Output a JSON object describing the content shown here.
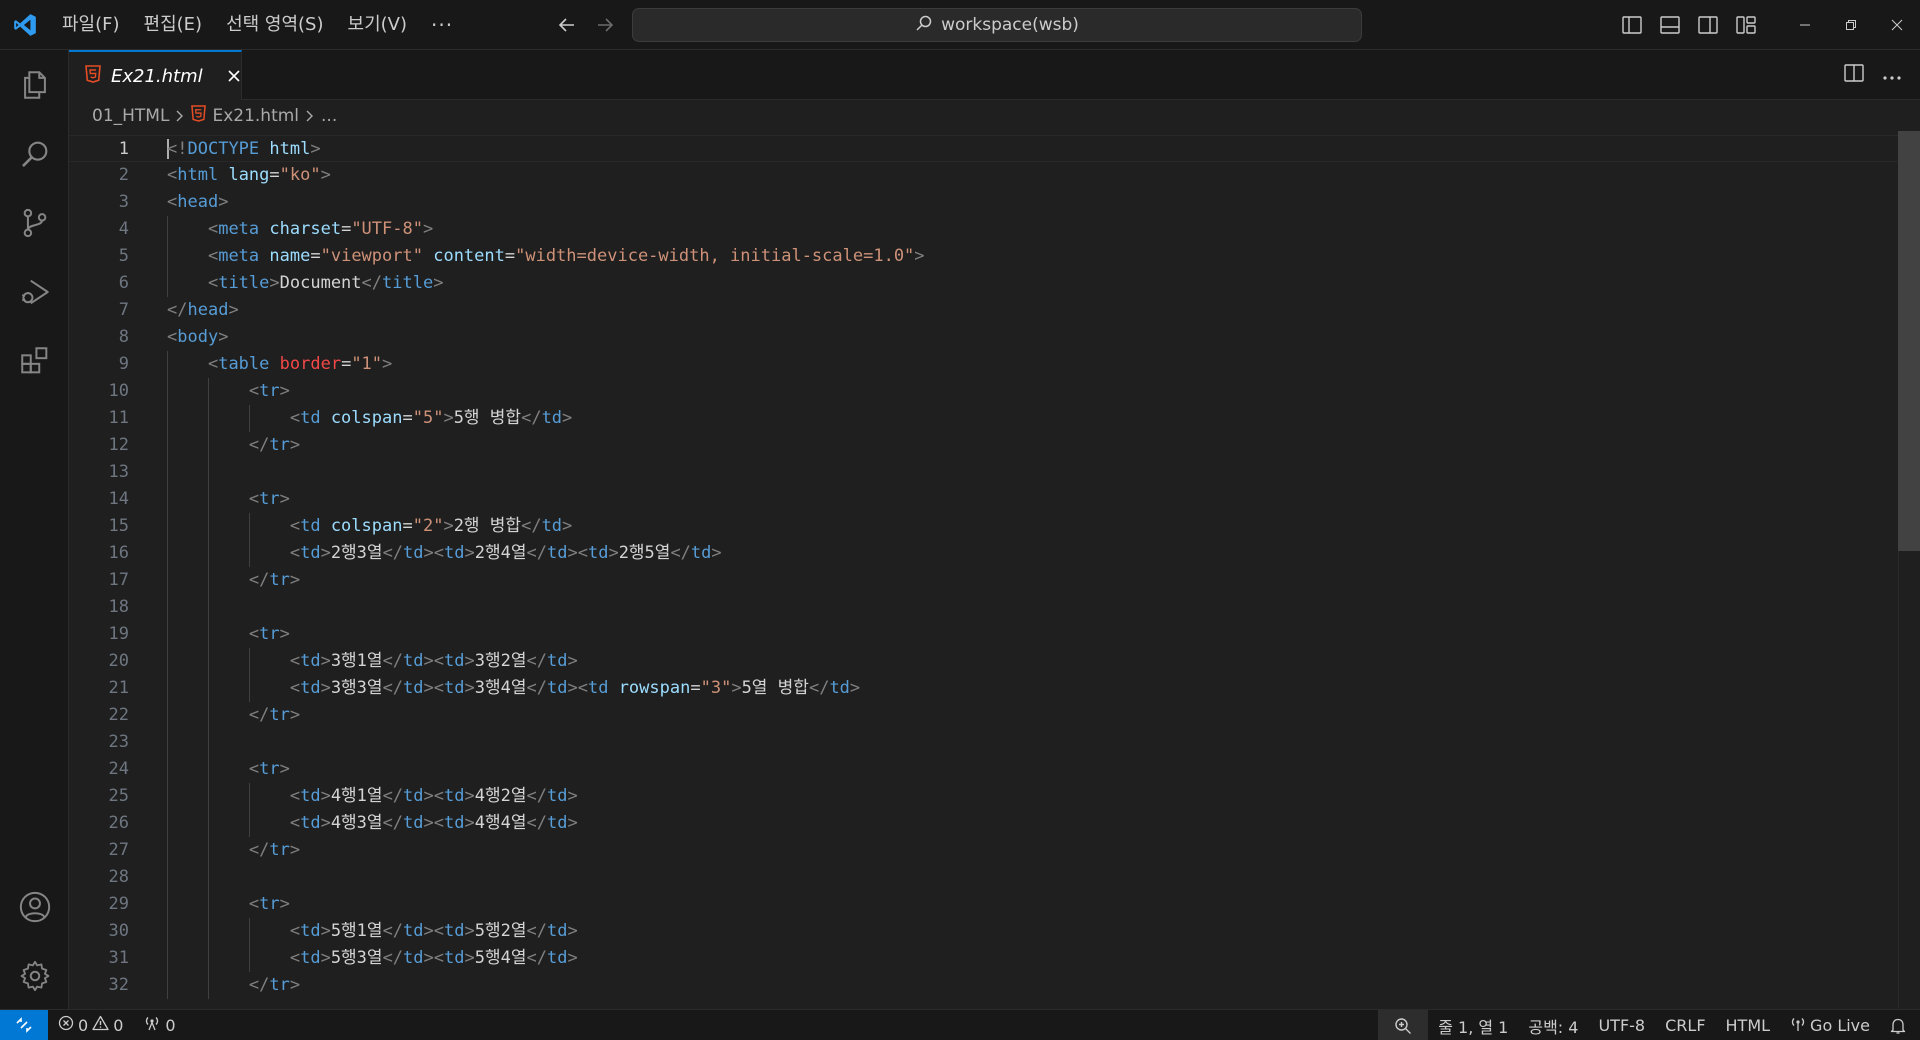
{
  "titlebar": {
    "menu": [
      "파일(F)",
      "편집(E)",
      "선택 영역(S)",
      "보기(V)"
    ],
    "more": "···",
    "search_text": "workspace(wsb)"
  },
  "tab": {
    "label": "Ex21.html"
  },
  "breadcrumb": {
    "folder": "01_HTML",
    "file": "Ex21.html",
    "more": "..."
  },
  "code": [
    [
      [
        "p",
        "<"
      ],
      [
        "p",
        "!"
      ],
      [
        "tag",
        "DOCTYPE"
      ],
      [
        "text",
        " "
      ],
      [
        "attr",
        "html"
      ],
      [
        "p",
        ">"
      ]
    ],
    [
      [
        "p",
        "<"
      ],
      [
        "tag",
        "html"
      ],
      [
        "text",
        " "
      ],
      [
        "attr",
        "lang"
      ],
      [
        "text",
        "="
      ],
      [
        "str",
        "\"ko\""
      ],
      [
        "p",
        ">"
      ]
    ],
    [
      [
        "p",
        "<"
      ],
      [
        "tag",
        "head"
      ],
      [
        "p",
        ">"
      ]
    ],
    [
      [
        "text",
        "    "
      ],
      [
        "p",
        "<"
      ],
      [
        "tag",
        "meta"
      ],
      [
        "text",
        " "
      ],
      [
        "attr",
        "charset"
      ],
      [
        "text",
        "="
      ],
      [
        "str",
        "\"UTF-8\""
      ],
      [
        "p",
        ">"
      ]
    ],
    [
      [
        "text",
        "    "
      ],
      [
        "p",
        "<"
      ],
      [
        "tag",
        "meta"
      ],
      [
        "text",
        " "
      ],
      [
        "attr",
        "name"
      ],
      [
        "text",
        "="
      ],
      [
        "str",
        "\"viewport\""
      ],
      [
        "text",
        " "
      ],
      [
        "attr",
        "content"
      ],
      [
        "text",
        "="
      ],
      [
        "str",
        "\"width=device-width, initial-scale=1.0\""
      ],
      [
        "p",
        ">"
      ]
    ],
    [
      [
        "text",
        "    "
      ],
      [
        "p",
        "<"
      ],
      [
        "tag",
        "title"
      ],
      [
        "p",
        ">"
      ],
      [
        "text",
        "Document"
      ],
      [
        "p",
        "</"
      ],
      [
        "tag",
        "title"
      ],
      [
        "p",
        ">"
      ]
    ],
    [
      [
        "p",
        "</"
      ],
      [
        "tag",
        "head"
      ],
      [
        "p",
        ">"
      ]
    ],
    [
      [
        "p",
        "<"
      ],
      [
        "tag",
        "body"
      ],
      [
        "p",
        ">"
      ]
    ],
    [
      [
        "text",
        "    "
      ],
      [
        "p",
        "<"
      ],
      [
        "tag",
        "table"
      ],
      [
        "text",
        " "
      ],
      [
        "err",
        "border"
      ],
      [
        "text",
        "="
      ],
      [
        "str",
        "\"1\""
      ],
      [
        "p",
        ">"
      ]
    ],
    [
      [
        "text",
        "        "
      ],
      [
        "p",
        "<"
      ],
      [
        "tag",
        "tr"
      ],
      [
        "p",
        ">"
      ]
    ],
    [
      [
        "text",
        "            "
      ],
      [
        "p",
        "<"
      ],
      [
        "tag",
        "td"
      ],
      [
        "text",
        " "
      ],
      [
        "attr",
        "colspan"
      ],
      [
        "text",
        "="
      ],
      [
        "str",
        "\"5\""
      ],
      [
        "p",
        ">"
      ],
      [
        "text",
        "5행 병합"
      ],
      [
        "p",
        "</"
      ],
      [
        "tag",
        "td"
      ],
      [
        "p",
        ">"
      ]
    ],
    [
      [
        "text",
        "        "
      ],
      [
        "p",
        "</"
      ],
      [
        "tag",
        "tr"
      ],
      [
        "p",
        ">"
      ]
    ],
    [],
    [
      [
        "text",
        "        "
      ],
      [
        "p",
        "<"
      ],
      [
        "tag",
        "tr"
      ],
      [
        "p",
        ">"
      ]
    ],
    [
      [
        "text",
        "            "
      ],
      [
        "p",
        "<"
      ],
      [
        "tag",
        "td"
      ],
      [
        "text",
        " "
      ],
      [
        "attr",
        "colspan"
      ],
      [
        "text",
        "="
      ],
      [
        "str",
        "\"2\""
      ],
      [
        "p",
        ">"
      ],
      [
        "text",
        "2행 병합"
      ],
      [
        "p",
        "</"
      ],
      [
        "tag",
        "td"
      ],
      [
        "p",
        ">"
      ]
    ],
    [
      [
        "text",
        "            "
      ],
      [
        "p",
        "<"
      ],
      [
        "tag",
        "td"
      ],
      [
        "p",
        ">"
      ],
      [
        "text",
        "2행3열"
      ],
      [
        "p",
        "</"
      ],
      [
        "tag",
        "td"
      ],
      [
        "p",
        "><"
      ],
      [
        "tag",
        "td"
      ],
      [
        "p",
        ">"
      ],
      [
        "text",
        "2행4열"
      ],
      [
        "p",
        "</"
      ],
      [
        "tag",
        "td"
      ],
      [
        "p",
        "><"
      ],
      [
        "tag",
        "td"
      ],
      [
        "p",
        ">"
      ],
      [
        "text",
        "2행5열"
      ],
      [
        "p",
        "</"
      ],
      [
        "tag",
        "td"
      ],
      [
        "p",
        ">"
      ]
    ],
    [
      [
        "text",
        "        "
      ],
      [
        "p",
        "</"
      ],
      [
        "tag",
        "tr"
      ],
      [
        "p",
        ">"
      ]
    ],
    [],
    [
      [
        "text",
        "        "
      ],
      [
        "p",
        "<"
      ],
      [
        "tag",
        "tr"
      ],
      [
        "p",
        ">"
      ]
    ],
    [
      [
        "text",
        "            "
      ],
      [
        "p",
        "<"
      ],
      [
        "tag",
        "td"
      ],
      [
        "p",
        ">"
      ],
      [
        "text",
        "3행1열"
      ],
      [
        "p",
        "</"
      ],
      [
        "tag",
        "td"
      ],
      [
        "p",
        "><"
      ],
      [
        "tag",
        "td"
      ],
      [
        "p",
        ">"
      ],
      [
        "text",
        "3행2열"
      ],
      [
        "p",
        "</"
      ],
      [
        "tag",
        "td"
      ],
      [
        "p",
        ">"
      ]
    ],
    [
      [
        "text",
        "            "
      ],
      [
        "p",
        "<"
      ],
      [
        "tag",
        "td"
      ],
      [
        "p",
        ">"
      ],
      [
        "text",
        "3행3열"
      ],
      [
        "p",
        "</"
      ],
      [
        "tag",
        "td"
      ],
      [
        "p",
        "><"
      ],
      [
        "tag",
        "td"
      ],
      [
        "p",
        ">"
      ],
      [
        "text",
        "3행4열"
      ],
      [
        "p",
        "</"
      ],
      [
        "tag",
        "td"
      ],
      [
        "p",
        "><"
      ],
      [
        "tag",
        "td"
      ],
      [
        "text",
        " "
      ],
      [
        "attr",
        "rowspan"
      ],
      [
        "text",
        "="
      ],
      [
        "str",
        "\"3\""
      ],
      [
        "p",
        ">"
      ],
      [
        "text",
        "5열 병합"
      ],
      [
        "p",
        "</"
      ],
      [
        "tag",
        "td"
      ],
      [
        "p",
        ">"
      ]
    ],
    [
      [
        "text",
        "        "
      ],
      [
        "p",
        "</"
      ],
      [
        "tag",
        "tr"
      ],
      [
        "p",
        ">"
      ]
    ],
    [],
    [
      [
        "text",
        "        "
      ],
      [
        "p",
        "<"
      ],
      [
        "tag",
        "tr"
      ],
      [
        "p",
        ">"
      ]
    ],
    [
      [
        "text",
        "            "
      ],
      [
        "p",
        "<"
      ],
      [
        "tag",
        "td"
      ],
      [
        "p",
        ">"
      ],
      [
        "text",
        "4행1열"
      ],
      [
        "p",
        "</"
      ],
      [
        "tag",
        "td"
      ],
      [
        "p",
        "><"
      ],
      [
        "tag",
        "td"
      ],
      [
        "p",
        ">"
      ],
      [
        "text",
        "4행2열"
      ],
      [
        "p",
        "</"
      ],
      [
        "tag",
        "td"
      ],
      [
        "p",
        ">"
      ]
    ],
    [
      [
        "text",
        "            "
      ],
      [
        "p",
        "<"
      ],
      [
        "tag",
        "td"
      ],
      [
        "p",
        ">"
      ],
      [
        "text",
        "4행3열"
      ],
      [
        "p",
        "</"
      ],
      [
        "tag",
        "td"
      ],
      [
        "p",
        "><"
      ],
      [
        "tag",
        "td"
      ],
      [
        "p",
        ">"
      ],
      [
        "text",
        "4행4열"
      ],
      [
        "p",
        "</"
      ],
      [
        "tag",
        "td"
      ],
      [
        "p",
        ">"
      ]
    ],
    [
      [
        "text",
        "        "
      ],
      [
        "p",
        "</"
      ],
      [
        "tag",
        "tr"
      ],
      [
        "p",
        ">"
      ]
    ],
    [],
    [
      [
        "text",
        "        "
      ],
      [
        "p",
        "<"
      ],
      [
        "tag",
        "tr"
      ],
      [
        "p",
        ">"
      ]
    ],
    [
      [
        "text",
        "            "
      ],
      [
        "p",
        "<"
      ],
      [
        "tag",
        "td"
      ],
      [
        "p",
        ">"
      ],
      [
        "text",
        "5행1열"
      ],
      [
        "p",
        "</"
      ],
      [
        "tag",
        "td"
      ],
      [
        "p",
        "><"
      ],
      [
        "tag",
        "td"
      ],
      [
        "p",
        ">"
      ],
      [
        "text",
        "5행2열"
      ],
      [
        "p",
        "</"
      ],
      [
        "tag",
        "td"
      ],
      [
        "p",
        ">"
      ]
    ],
    [
      [
        "text",
        "            "
      ],
      [
        "p",
        "<"
      ],
      [
        "tag",
        "td"
      ],
      [
        "p",
        ">"
      ],
      [
        "text",
        "5행3열"
      ],
      [
        "p",
        "</"
      ],
      [
        "tag",
        "td"
      ],
      [
        "p",
        "><"
      ],
      [
        "tag",
        "td"
      ],
      [
        "p",
        ">"
      ],
      [
        "text",
        "5행4열"
      ],
      [
        "p",
        "</"
      ],
      [
        "tag",
        "td"
      ],
      [
        "p",
        ">"
      ]
    ],
    [
      [
        "text",
        "        "
      ],
      [
        "p",
        "</"
      ],
      [
        "tag",
        "tr"
      ],
      [
        "p",
        ">"
      ]
    ]
  ],
  "active_line": 1,
  "statusbar": {
    "errors": "0",
    "warnings": "0",
    "ports": "0",
    "position": "줄 1, 열 1",
    "spaces": "공백: 4",
    "encoding": "UTF-8",
    "eol": "CRLF",
    "language": "HTML",
    "golive": "Go Live"
  },
  "colors": {
    "accent": "#0078d4",
    "html_icon": "#e44d26",
    "tag": "#569cd6",
    "attribute": "#9cdcfe",
    "string": "#ce9178",
    "error_attribute": "#f44747"
  }
}
